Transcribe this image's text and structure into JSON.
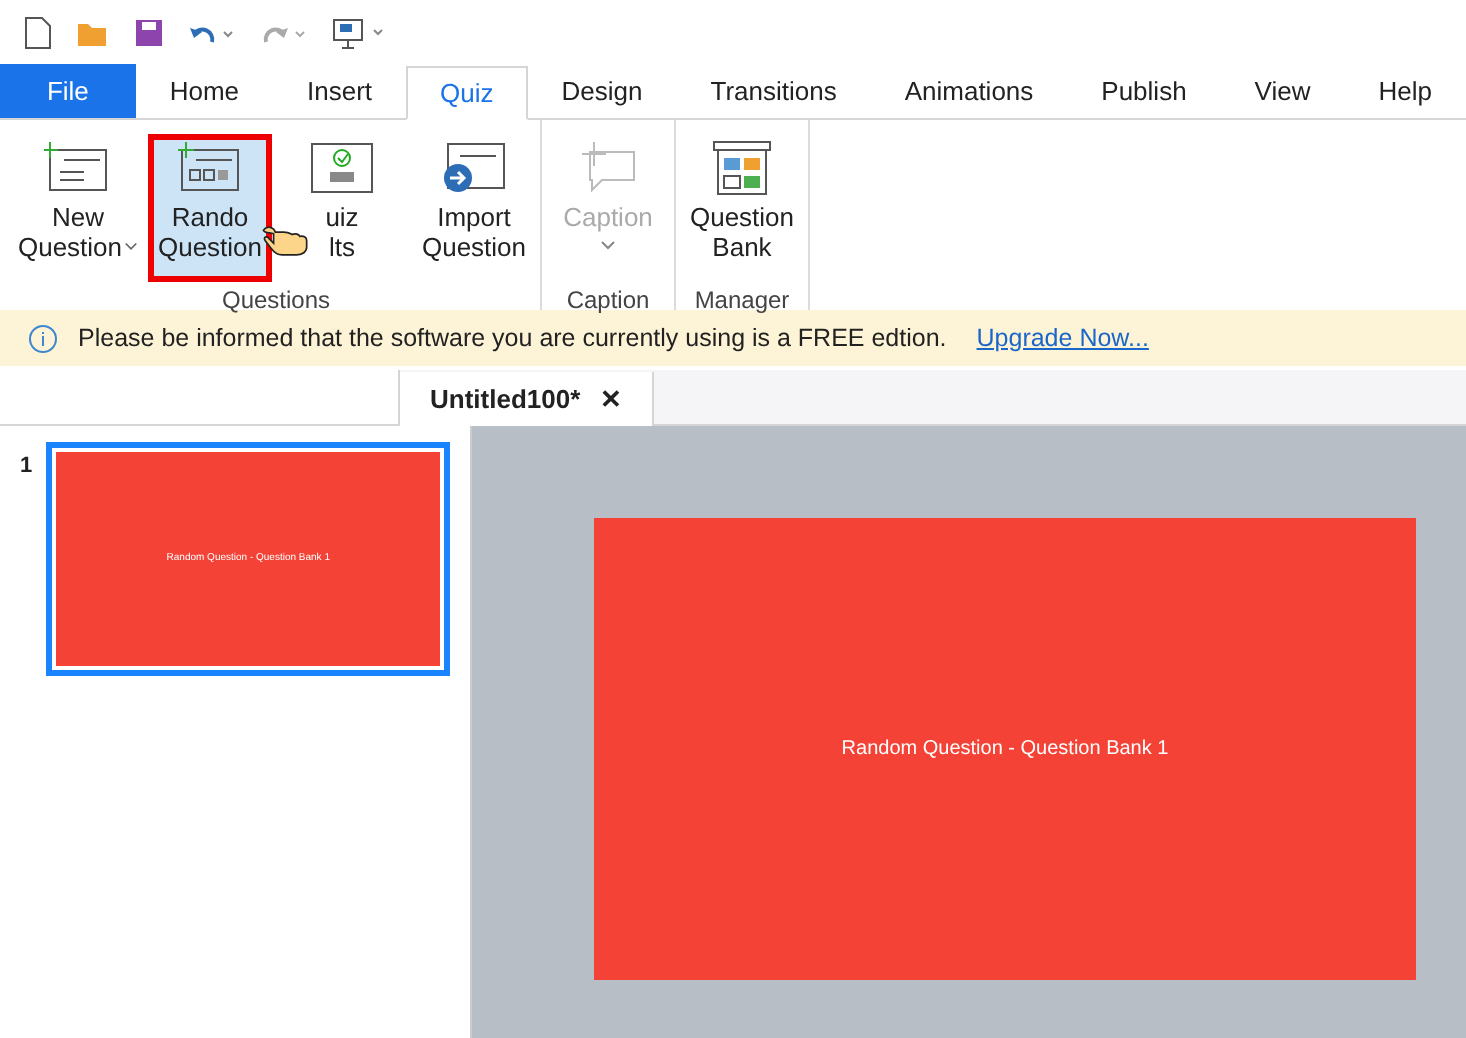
{
  "tabs": [
    {
      "label": "File",
      "kind": "file",
      "selected": false
    },
    {
      "label": "Home",
      "kind": "tab",
      "selected": false
    },
    {
      "label": "Insert",
      "kind": "tab",
      "selected": false
    },
    {
      "label": "Quiz",
      "kind": "tab",
      "selected": true
    },
    {
      "label": "Design",
      "kind": "tab",
      "selected": false
    },
    {
      "label": "Transitions",
      "kind": "tab",
      "selected": false
    },
    {
      "label": "Animations",
      "kind": "tab",
      "selected": false
    },
    {
      "label": "Publish",
      "kind": "tab",
      "selected": false
    },
    {
      "label": "View",
      "kind": "tab",
      "selected": false
    },
    {
      "label": "Help",
      "kind": "tab",
      "selected": false
    }
  ],
  "ribbon_groups": [
    {
      "label": "Questions",
      "buttons": [
        {
          "kind": "new",
          "lines": [
            "New",
            "Question"
          ],
          "dropdown": true,
          "disabled": false,
          "highlighted": false
        },
        {
          "kind": "random",
          "lines": [
            "Rando",
            "Question"
          ],
          "dropdown": false,
          "disabled": false,
          "highlighted": true
        },
        {
          "kind": "results",
          "lines": [
            "uiz",
            "lts"
          ],
          "dropdown": false,
          "disabled": false,
          "highlighted": false
        },
        {
          "kind": "import",
          "lines": [
            "Import",
            "Question"
          ],
          "dropdown": false,
          "disabled": false,
          "highlighted": false
        }
      ]
    },
    {
      "label": "Caption",
      "buttons": [
        {
          "kind": "caption",
          "lines": [
            "Caption"
          ],
          "dropdown": true,
          "disabled": true,
          "highlighted": false
        }
      ]
    },
    {
      "label": "Manager",
      "buttons": [
        {
          "kind": "bank",
          "lines": [
            "Question",
            "Bank"
          ],
          "dropdown": false,
          "disabled": false,
          "highlighted": false
        }
      ]
    }
  ],
  "notice": {
    "text": "Please be informed that the software you are currently using is a FREE edtion.",
    "link": "Upgrade Now..."
  },
  "document_tab": {
    "title": "Untitled100*",
    "close": "✕"
  },
  "slides": [
    {
      "number": "1",
      "title": "Random Question - Question Bank 1",
      "selected": true
    }
  ],
  "canvas": {
    "title": "Random Question - Question Bank 1"
  }
}
